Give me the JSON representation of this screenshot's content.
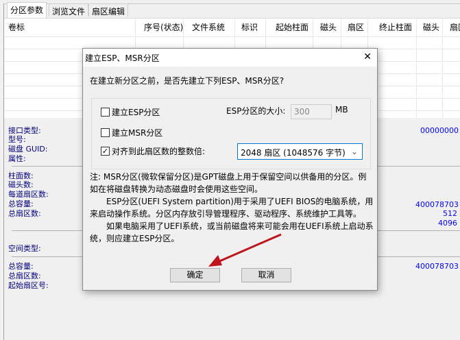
{
  "tabs": [
    "分区参数",
    "浏览文件",
    "扇区编辑"
  ],
  "columns": [
    "卷标",
    "序号(状态)",
    "文件系统",
    "标识",
    "起始柱面",
    "磁头",
    "扇区",
    "终止柱面",
    "磁头",
    "扇区"
  ],
  "disk_labels": [
    "接口类型:",
    "型号:",
    "磁盘 GUID:",
    "属性:"
  ],
  "geom_labels": [
    "柱面数:",
    "磁头数:",
    "每道扇区数:",
    "总容量:",
    "总扇区数:"
  ],
  "space_label": "空间类型:",
  "part_labels": [
    "总容量:",
    "总扇区数:",
    "起始扇区号:"
  ],
  "values": {
    "guid": "00000000",
    "capacity": "400078703",
    "bytes_per_sector": "512",
    "physical_sector": "4096",
    "part_capacity": "400078703"
  },
  "dialog": {
    "title": "建立ESP、MSR分区",
    "close": "✕",
    "question": "在建立新分区之前，是否先建立下列ESP、MSR分区?",
    "esp_checkbox": {
      "label": "建立ESP分区",
      "checked": false
    },
    "msr_checkbox": {
      "label": "建立MSR分区",
      "checked": false
    },
    "align_checkbox": {
      "label": "对齐到此扇区数的整数倍:",
      "checked": true,
      "mark": "✓"
    },
    "esp_size_label": "ESP分区的大小:",
    "esp_size_value": "300",
    "esp_size_unit": "MB",
    "align_select": "2048 扇区 (1048576 字节)",
    "note_lines": [
      "注: MSR分区(微软保留分区)是GPT磁盘上用于保留空间以供备用的分区。例如在将磁盘转换为动态磁盘时会使用这些空间。",
      "ESP分区(UEFI System partition)用于采用了UEFI BIOS的电脑系统，用来启动操作系统。分区内存放引导管理程序、驱动程序、系统维护工具等。",
      "如果电脑采用了UEFI系统，或当前磁盘将来可能会用在UEFI系统上启动系统，则应建立ESP分区。"
    ],
    "ok": "确定",
    "cancel": "取消"
  },
  "colors": {
    "arrow": "#c0141c",
    "label": "#000080",
    "value": "#0000ff"
  }
}
